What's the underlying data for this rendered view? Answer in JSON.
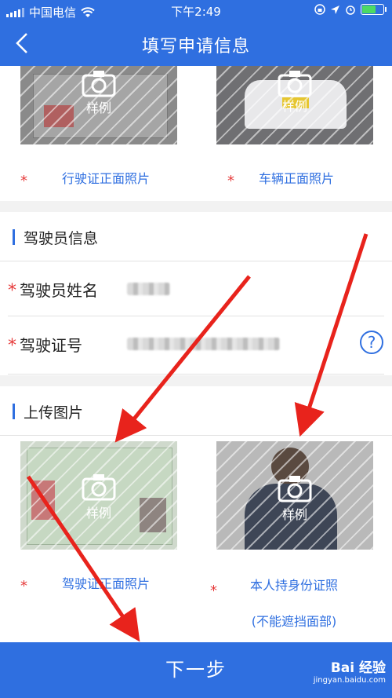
{
  "status_bar": {
    "carrier": "中国电信",
    "time": "下午2:49",
    "battery_percent": 70
  },
  "nav": {
    "title": "填写申请信息",
    "back_icon": "chevron-left-icon"
  },
  "vehicle_photos": {
    "items": [
      {
        "caption": "行驶证正面照片",
        "sample": "样例"
      },
      {
        "caption": "车辆正面照片",
        "sample": "样例"
      }
    ]
  },
  "driver_info": {
    "title": "驾驶员信息",
    "fields": [
      {
        "label": "驾驶员姓名",
        "required_mark": "*"
      },
      {
        "label": "驾驶证号",
        "required_mark": "*",
        "help": "?"
      }
    ]
  },
  "upload": {
    "title": "上传图片",
    "items": [
      {
        "caption": "驾驶证正面照片",
        "sample": "样例"
      },
      {
        "caption": "本人持身份证照",
        "caption2": "(不能遮挡面部)",
        "sample": "样例"
      }
    ]
  },
  "footer": {
    "next_label": "下一步",
    "watermark": "Bai 经验",
    "watermark_url": "jingyan.baidu.com"
  },
  "colors": {
    "primary": "#2f6fe0",
    "required": "#e63b3b",
    "annotation_arrow": "#e8231c"
  }
}
